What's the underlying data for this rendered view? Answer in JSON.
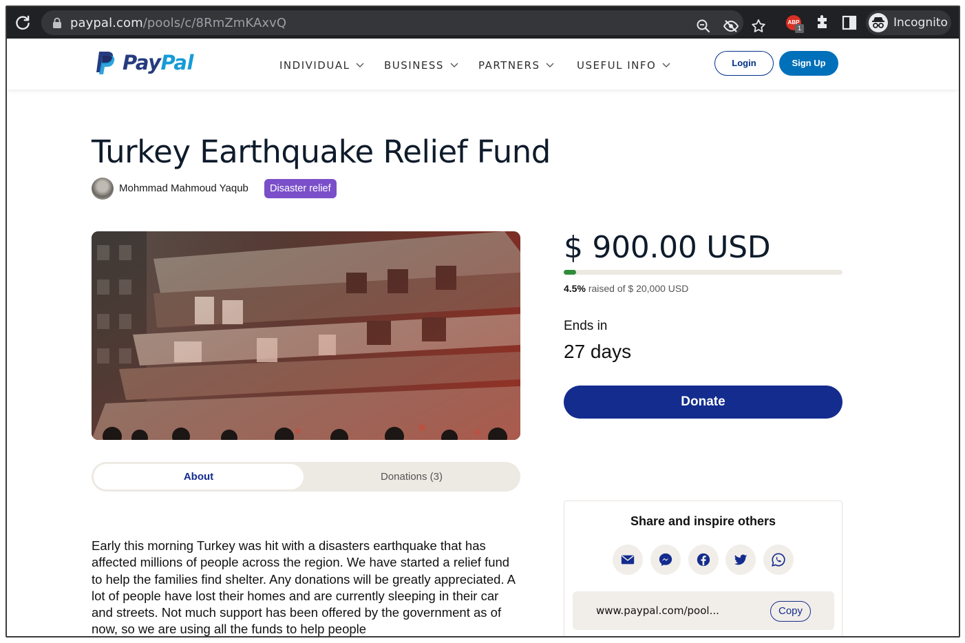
{
  "browser": {
    "url_host": "paypal.com",
    "url_path": "/pools/c/8RmZmKAxvQ",
    "abp_badge": "ABP",
    "abp_count": "1",
    "profile_label": "Incognito"
  },
  "header": {
    "logo_pay": "Pay",
    "logo_pal": "Pal",
    "nav": [
      "INDIVIDUAL",
      "BUSINESS",
      "PARTNERS",
      "USEFUL INFO"
    ],
    "login_label": "Login",
    "signup_label": "Sign Up"
  },
  "pool": {
    "title": "Turkey Earthquake Relief Fund",
    "organizer": "Mohmmad Mahmoud Yaqub",
    "category": "Disaster relief",
    "amount": "$ 900.00 USD",
    "percent_label": "4.5%",
    "progress_fraction": 0.045,
    "raised_suffix": "raised of $ 20,000 USD",
    "ends_label": "Ends in",
    "ends_value": "27 days",
    "donate_label": "Donate"
  },
  "tabs": {
    "about": "About",
    "donations": "Donations (3)"
  },
  "about_text": "Early this morning Turkey was hit with a disasters earthquake that has affected millions of people across the region. We have started a relief fund to help the families find shelter. Any donations will be greatly appreciated. A lot of people have lost their homes and are currently sleeping in their car and streets. Not much support has been offered by the government as of now, so we are using all the funds to help people",
  "share": {
    "title": "Share and inspire others",
    "icons": [
      "email-icon",
      "messenger-icon",
      "facebook-icon",
      "twitter-icon",
      "whatsapp-icon"
    ],
    "link": "www.paypal.com/pool...",
    "copy_label": "Copy"
  },
  "colors": {
    "paypal_navy": "#253b80",
    "paypal_blue": "#179bd7",
    "donate_blue": "#142c8e",
    "badge_purple": "#7a4fc9",
    "progress_green": "#2f8c3a"
  }
}
